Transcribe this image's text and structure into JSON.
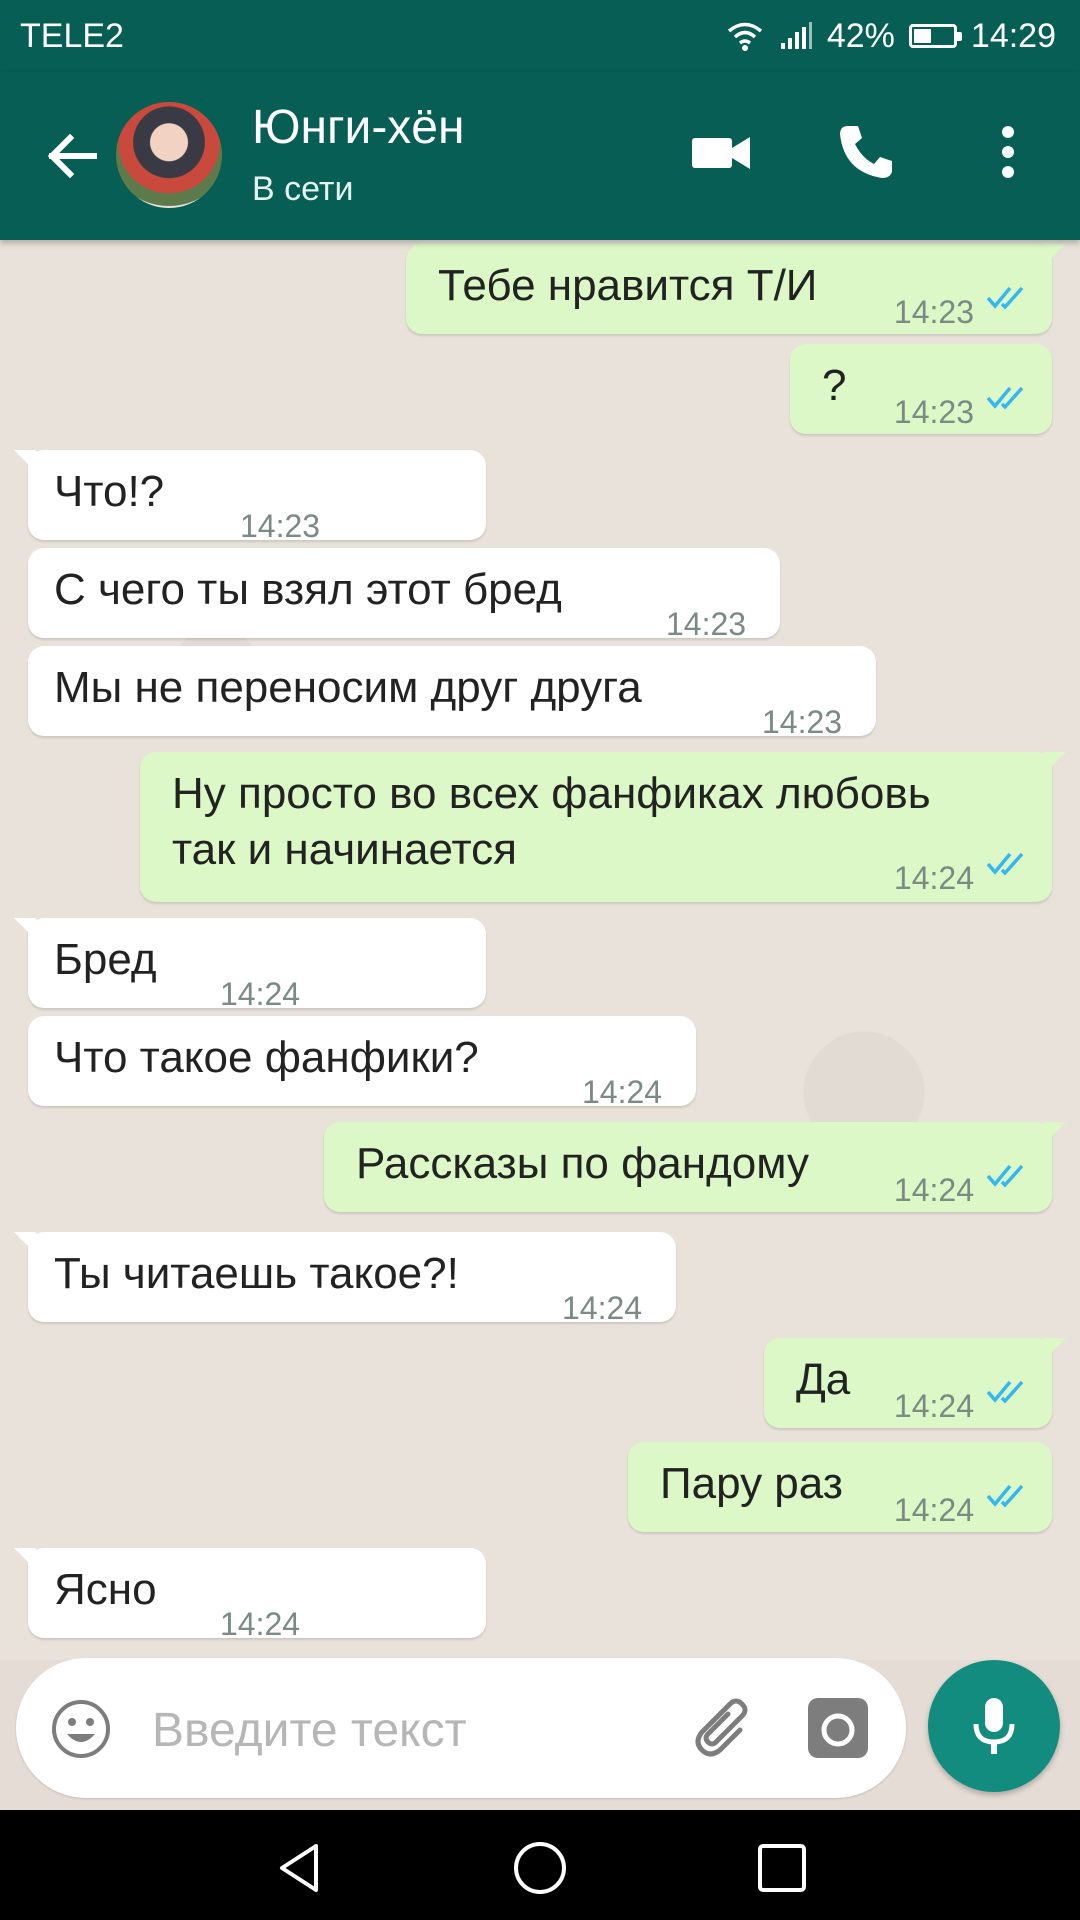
{
  "status_bar": {
    "carrier": "TELE2",
    "battery": "42%",
    "time": "14:29"
  },
  "header": {
    "name": "Юнги-хён",
    "status": "В сети"
  },
  "messages": [
    {
      "dir": "out",
      "text": "Тебе нравится Т/И",
      "time": "14:23",
      "read": true
    },
    {
      "dir": "out",
      "text": "?",
      "time": "14:23",
      "read": true
    },
    {
      "dir": "in",
      "text": "Что!?",
      "time": "14:23"
    },
    {
      "dir": "in",
      "text": "С чего ты взял этот бред",
      "time": "14:23"
    },
    {
      "dir": "in",
      "text": "Мы не переносим друг друга",
      "time": "14:23"
    },
    {
      "dir": "out",
      "text_line1": "Ну просто во всех фанфиках любовь",
      "text_line2": "так и начинается",
      "time": "14:24",
      "read": true
    },
    {
      "dir": "in",
      "text": "Бред",
      "time": "14:24"
    },
    {
      "dir": "in",
      "text": "Что такое фанфики?",
      "time": "14:24"
    },
    {
      "dir": "out",
      "text": "Рассказы по фандому",
      "time": "14:24",
      "read": true
    },
    {
      "dir": "in",
      "text": "Ты читаешь такое?!",
      "time": "14:24"
    },
    {
      "dir": "out",
      "text": "Да",
      "time": "14:24",
      "read": true
    },
    {
      "dir": "out",
      "text": "Пару раз",
      "time": "14:24",
      "read": true
    },
    {
      "dir": "in",
      "text": "Ясно",
      "time": "14:24"
    }
  ],
  "input": {
    "placeholder": "Введите текст"
  },
  "colors": {
    "header": "#075e54",
    "outgoing": "#dcf8c6",
    "incoming": "#ffffff",
    "accent": "#128c7e",
    "read_ticks": "#34b7f1"
  },
  "icons": [
    "back-arrow-icon",
    "video-call-icon",
    "phone-icon",
    "more-vert-icon",
    "emoji-icon",
    "paperclip-icon",
    "camera-icon",
    "mic-icon",
    "wifi-icon",
    "signal-icon",
    "battery-icon"
  ]
}
